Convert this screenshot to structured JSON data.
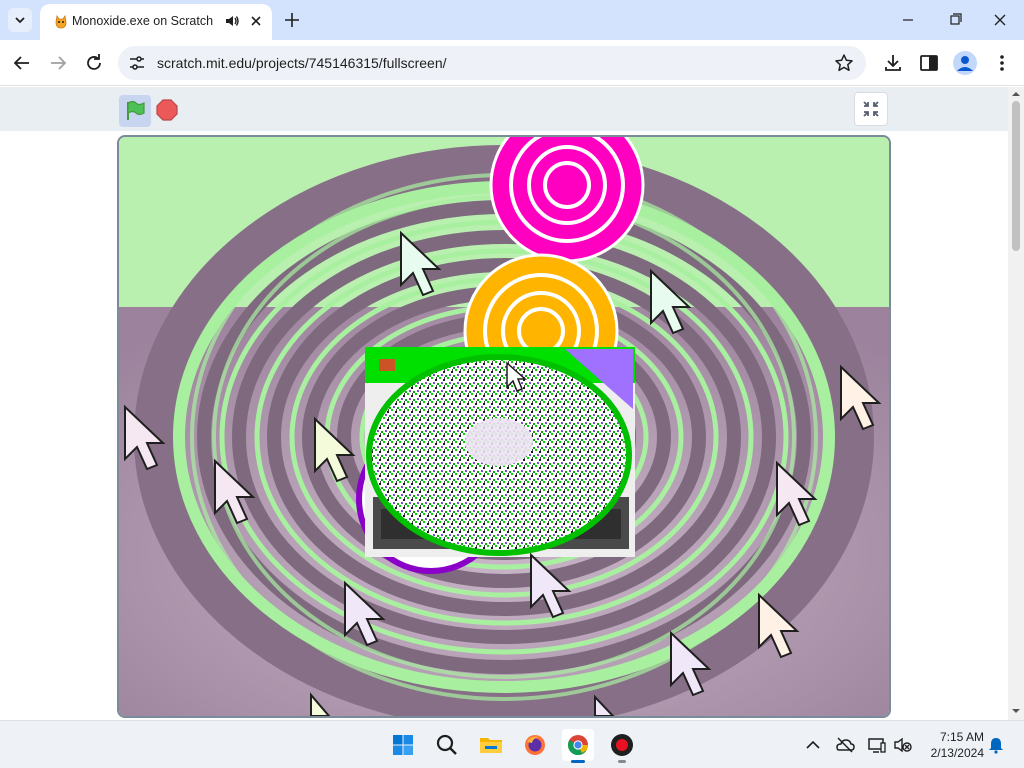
{
  "browser": {
    "tab": {
      "title": "Monoxide.exe on Scratch",
      "favicon": "scratch-cat-icon",
      "audio_icon": "speaker-icon",
      "close_icon": "close-icon"
    },
    "new_tab_icon": "plus-icon",
    "window_controls": [
      "minimize-icon",
      "maximize-icon",
      "close-icon"
    ],
    "address": {
      "url": "scratch.mit.edu/projects/745146315/fullscreen/"
    },
    "accent_color": "#d3e3fd"
  },
  "scratch": {
    "controls": {
      "green_flag_icon": "green-flag-icon",
      "stop_icon": "stop-sign-icon",
      "exit_fullscreen_icon": "collapse-icon"
    },
    "stage_colors": {
      "rings": "#a8f0a0",
      "stone": "#b8a0b8",
      "magenta": "#ff00c0",
      "amber": "#ffb400",
      "glitch_green": "#00e000",
      "purple": "#a070ff"
    }
  },
  "taskbar": {
    "apps": [
      "windows-start-icon",
      "search-icon",
      "file-explorer-icon",
      "firefox-icon",
      "chrome-icon",
      "recorder-icon"
    ],
    "tray": [
      "chevron-up-icon",
      "onedrive-icon",
      "display-icon",
      "volume-muted-icon",
      "notification-bell-icon"
    ],
    "time": "7:15 AM",
    "date": "2/13/2024"
  }
}
